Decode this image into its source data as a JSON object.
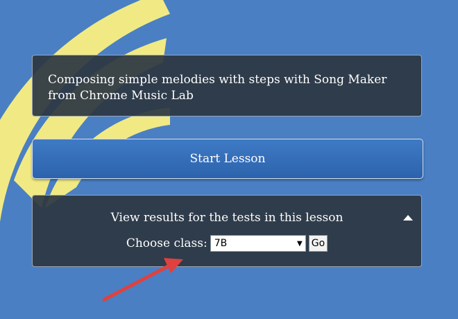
{
  "lesson": {
    "title": "Composing simple melodies with steps with Song Maker from Chrome Music Lab"
  },
  "start_button": {
    "label": "Start Lesson"
  },
  "results": {
    "title": "View results for the tests in this lesson",
    "class_label": "Choose class:",
    "class_selected": "7B",
    "go_label": "Go"
  },
  "colors": {
    "background": "#4a7fc3",
    "arc": "#f1ea84",
    "card": "#2d3742",
    "button": "#3a72be",
    "annotation_arrow": "#e0413f"
  },
  "icons": {
    "collapse": "triangle-up-icon",
    "dropdown": "chevron-down-icon",
    "annotation": "red-arrow-icon"
  }
}
